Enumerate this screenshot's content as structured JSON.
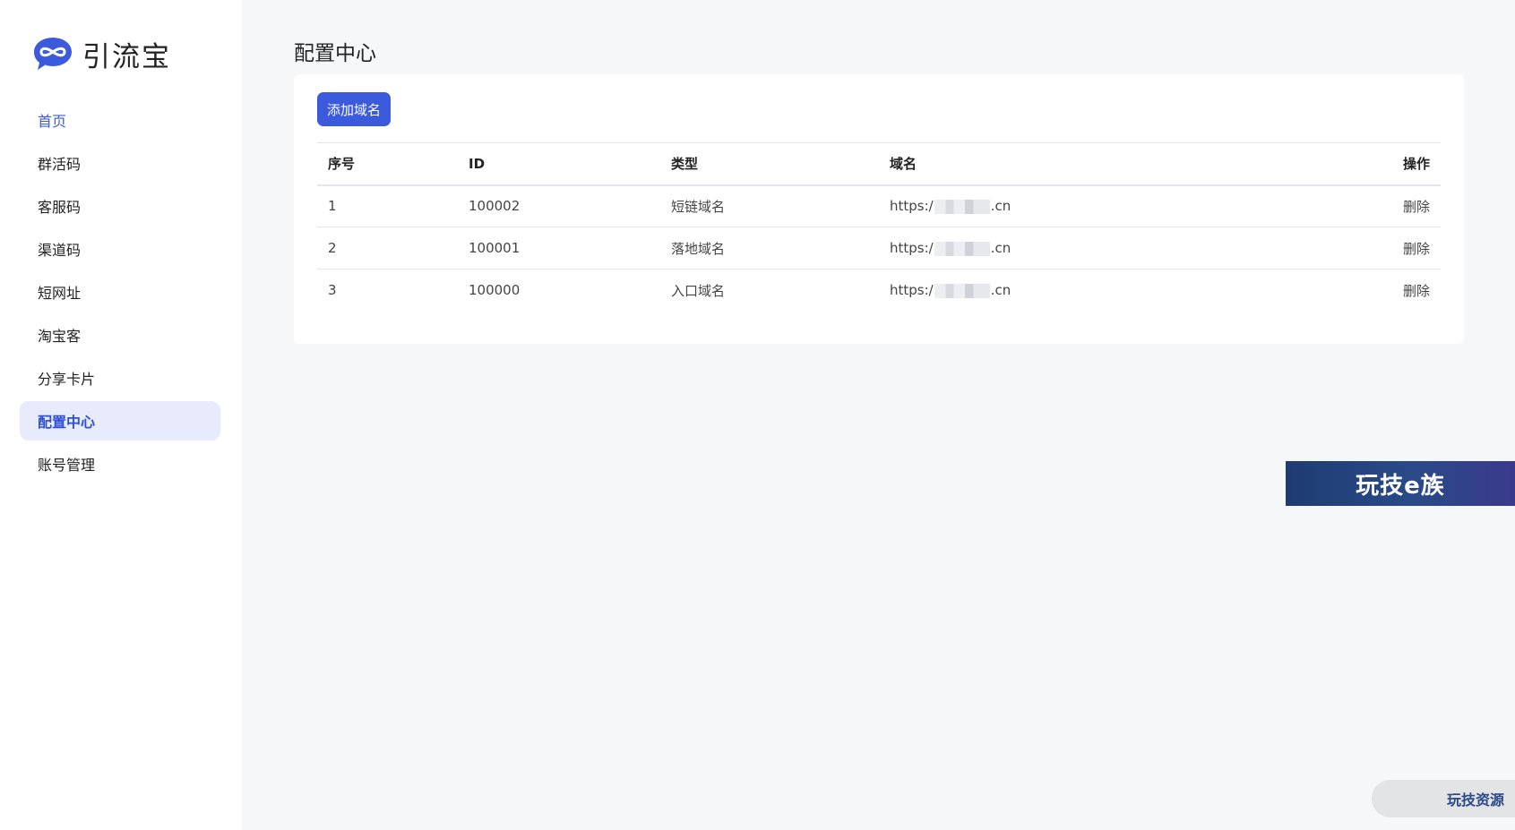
{
  "brand": {
    "name": "引流宝",
    "logo_icon": "infinity-chat-icon",
    "accent": "#3c5bdc"
  },
  "sidebar": {
    "items": [
      {
        "label": "首页"
      },
      {
        "label": "群活码"
      },
      {
        "label": "客服码"
      },
      {
        "label": "渠道码"
      },
      {
        "label": "短网址"
      },
      {
        "label": "淘宝客"
      },
      {
        "label": "分享卡片"
      },
      {
        "label": "配置中心",
        "active": true
      },
      {
        "label": "账号管理"
      }
    ]
  },
  "page": {
    "title": "配置中心",
    "add_button_label": "添加域名"
  },
  "table": {
    "headers": {
      "seq": "序号",
      "id": "ID",
      "type": "类型",
      "domain": "域名",
      "op": "操作"
    },
    "rows": [
      {
        "seq": "1",
        "id": "100002",
        "type": "短链域名",
        "domain_prefix": "https:/",
        "domain_suffix": ".cn",
        "op": "删除"
      },
      {
        "seq": "2",
        "id": "100001",
        "type": "落地域名",
        "domain_prefix": "https:/",
        "domain_suffix": ".cn",
        "op": "删除"
      },
      {
        "seq": "3",
        "id": "100000",
        "type": "入口域名",
        "domain_prefix": "https:/",
        "domain_suffix": ".cn",
        "op": "删除"
      }
    ]
  },
  "watermarks": {
    "banner_text": "玩技e族",
    "pill_text": "玩技资源"
  }
}
